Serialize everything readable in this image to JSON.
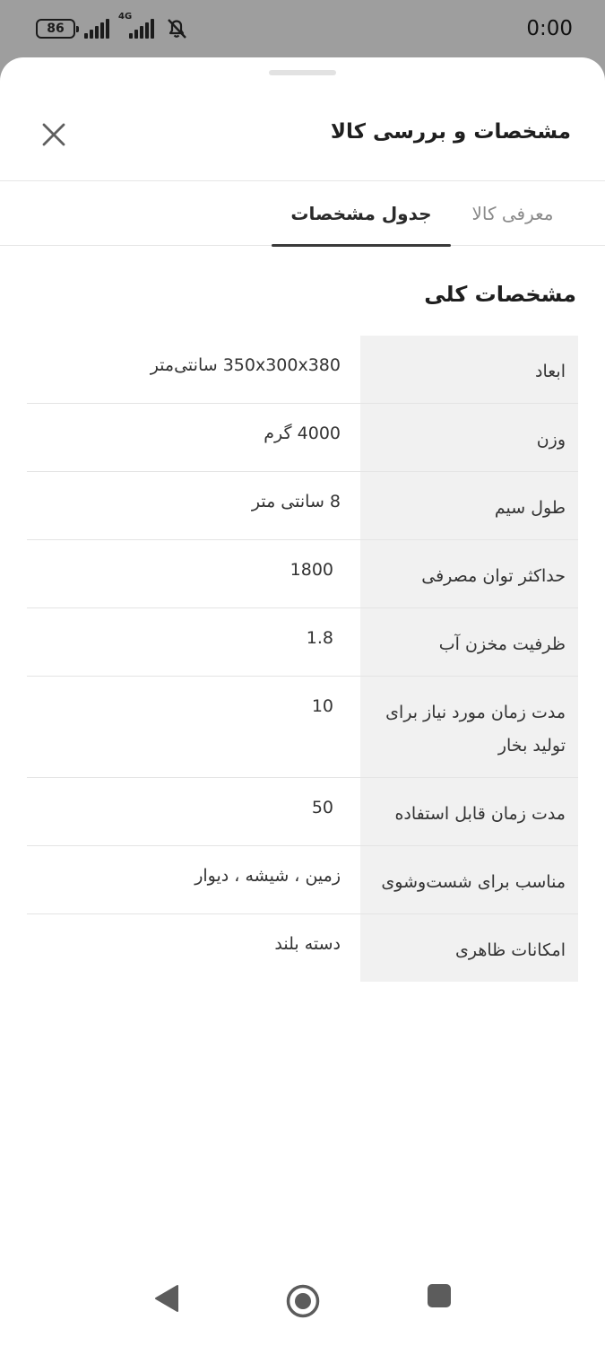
{
  "status_bar": {
    "battery": "86",
    "network": "4G",
    "time": "0:00"
  },
  "sheet": {
    "title": "مشخصات و بررسی کالا",
    "tabs": [
      {
        "label": "معرفی کالا",
        "active": false
      },
      {
        "label": "جدول مشخصات",
        "active": true
      }
    ],
    "section_title": "مشخصات کلی",
    "specs": [
      {
        "key": "ابعاد",
        "value": "350x300x380 سانتی‌متر"
      },
      {
        "key": "وزن",
        "value": "4000 گرم"
      },
      {
        "key": "طول سیم",
        "value": "8 سانتی متر"
      },
      {
        "key": "حداکثر توان مصرفی",
        "value": "1800"
      },
      {
        "key": "ظرفیت مخزن آب",
        "value": "1.8"
      },
      {
        "key": "مدت زمان مورد نیاز برای تولید بخار",
        "value": "10"
      },
      {
        "key": "مدت زمان قابل استفاده",
        "value": "50"
      },
      {
        "key": "مناسب برای شست‌وشوی",
        "value": "زمین ، شیشه ، دیوار"
      },
      {
        "key": "امکانات ظاهری",
        "value": "دسته بلند"
      }
    ]
  },
  "icons": {
    "close": "close-icon",
    "back": "back-triangle-icon",
    "home": "home-circle-icon",
    "recent": "recent-square-icon"
  },
  "colors": {
    "status_bar_bg": "#9e9e9e",
    "key_cell_bg": "#f1f1f1",
    "active_tab_underline": "#3a3a3a"
  }
}
